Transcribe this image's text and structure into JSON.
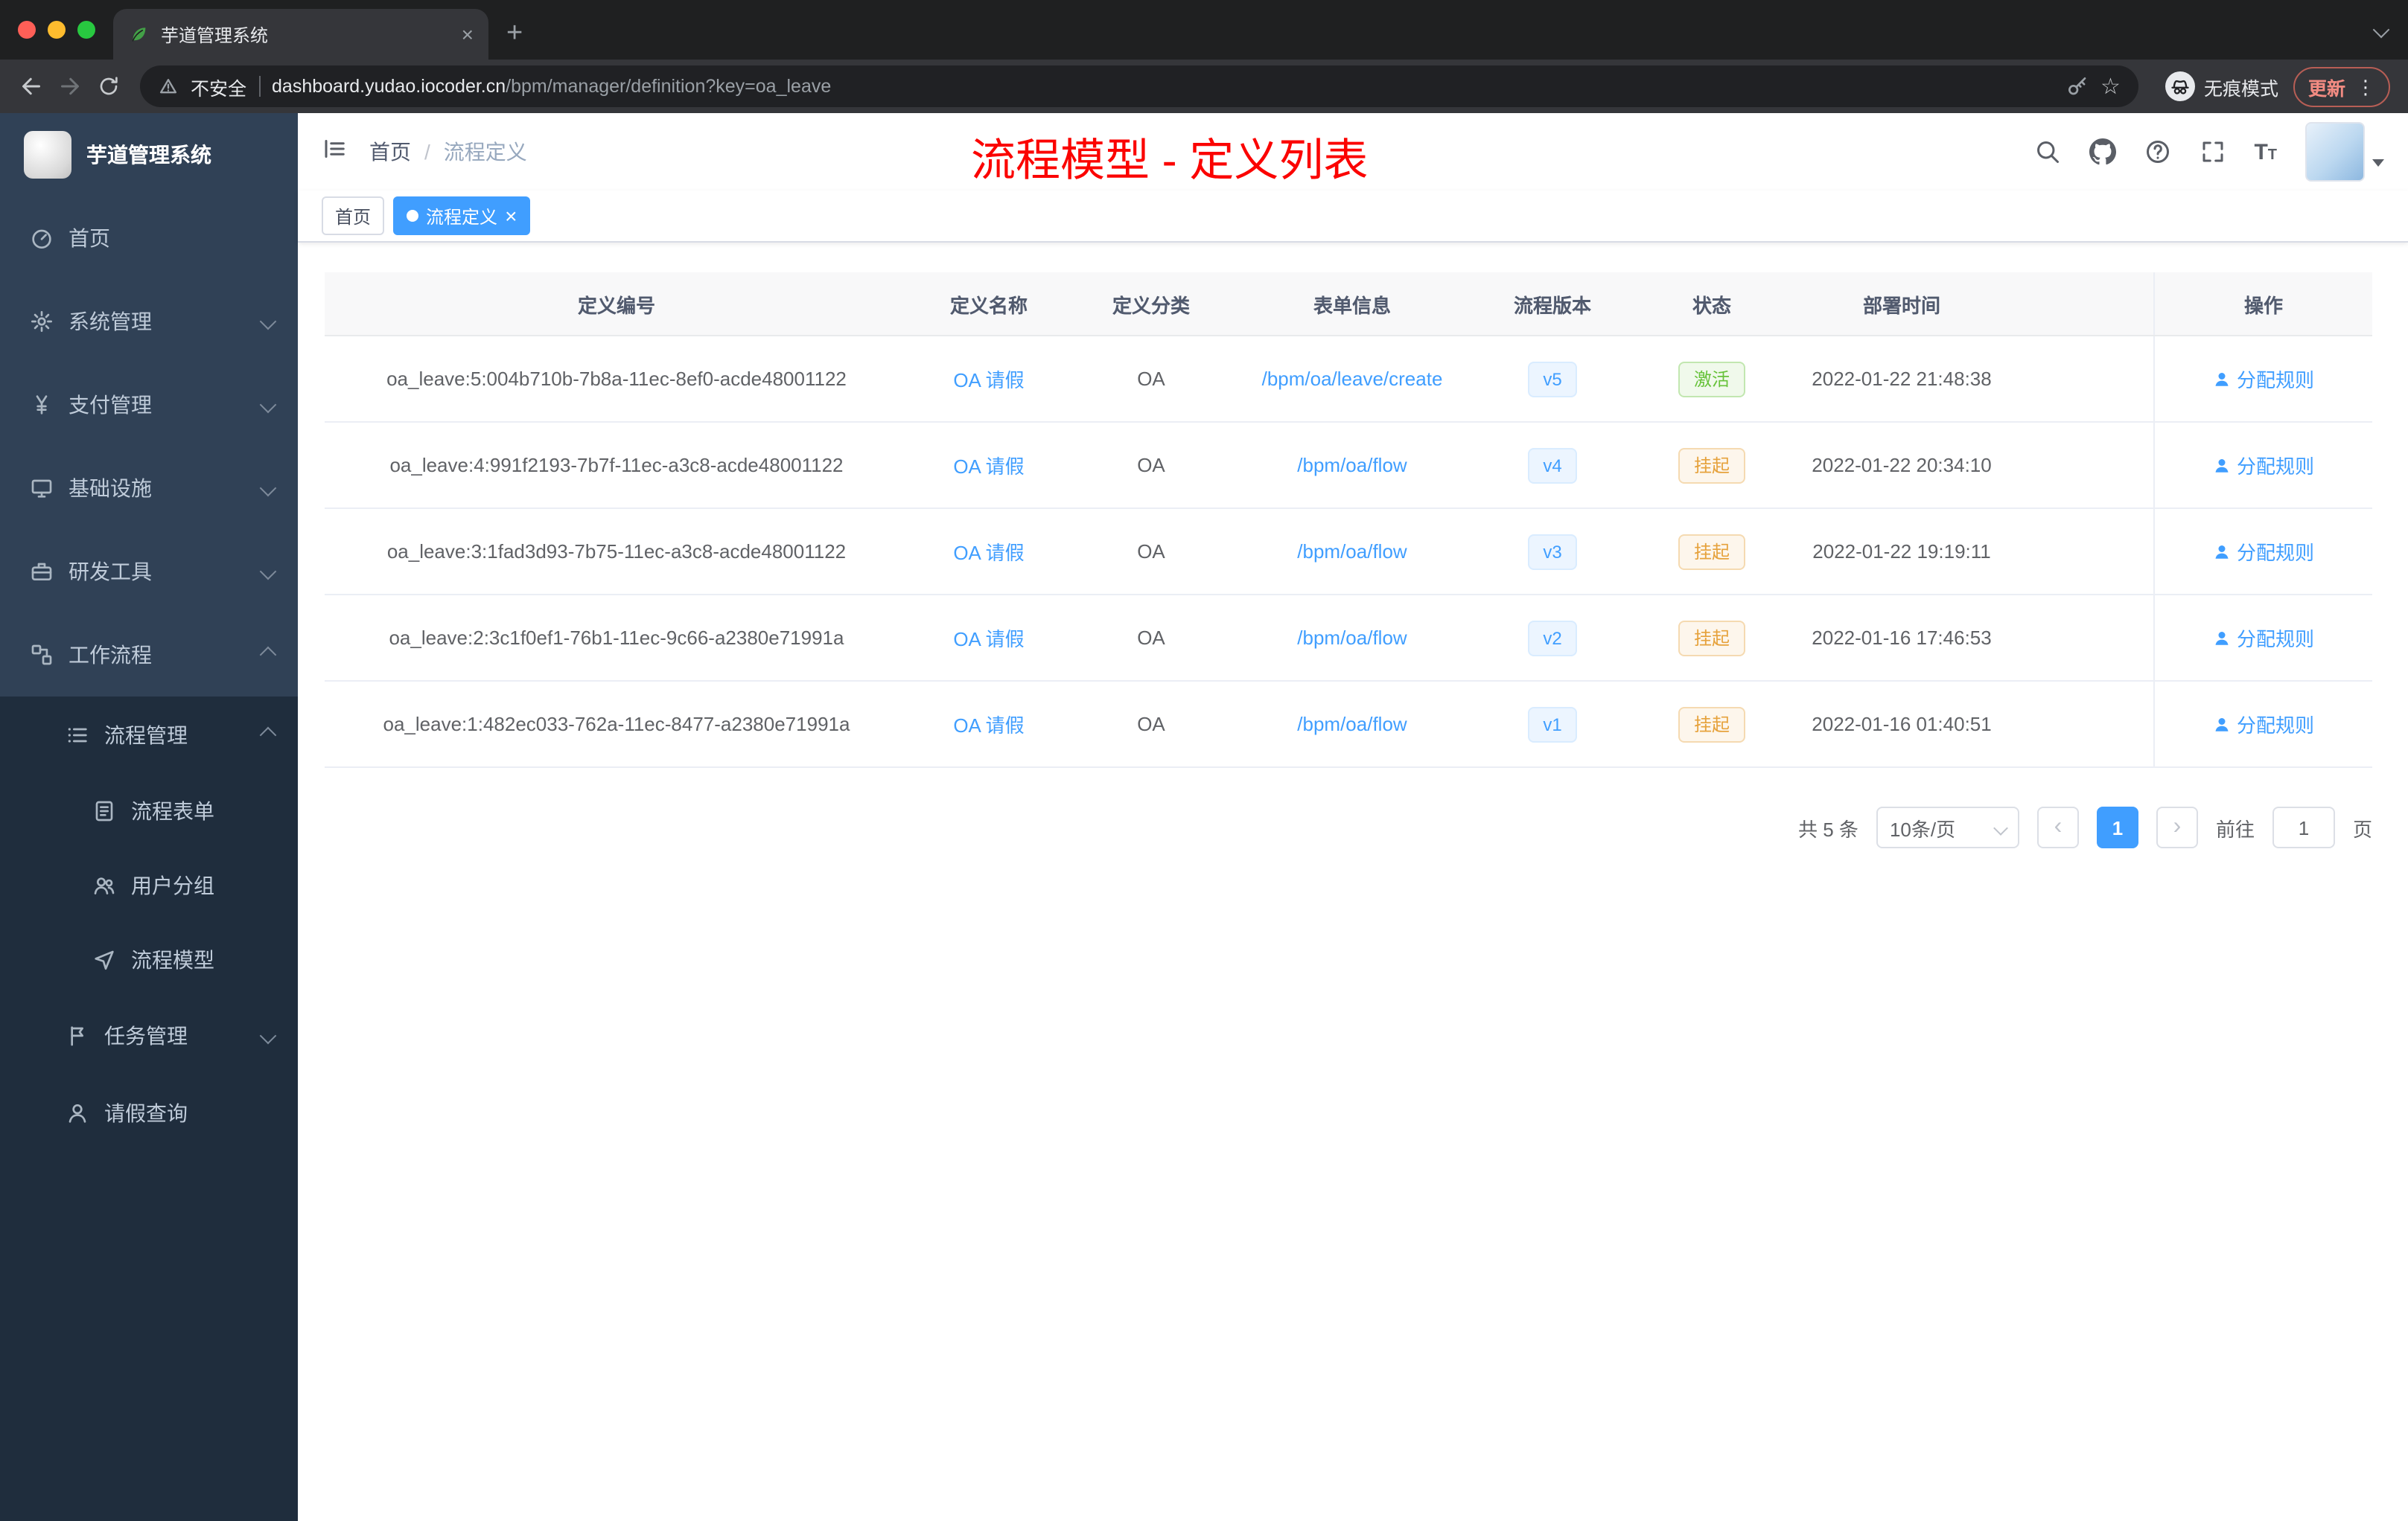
{
  "colors": {
    "accent": "#409eff",
    "success_text": "#67c23a",
    "warning_text": "#e6a23c",
    "annotation_red": "#fb0300",
    "sidebar_bg": "#304156",
    "submenu_bg": "#1f2d3d"
  },
  "browser": {
    "tab_title": "芋道管理系统",
    "security_label": "不安全",
    "url_host": "dashboard.yudao.iocoder.cn",
    "url_path": "/bpm/manager/definition?key=oa_leave",
    "incognito_label": "无痕模式",
    "update_label": "更新"
  },
  "sidebar": {
    "logo_title": "芋道管理系统",
    "main_items": [
      {
        "label": "首页",
        "icon": "dashboard-icon",
        "chevron": "none",
        "level": 0
      },
      {
        "label": "系统管理",
        "icon": "gear-icon",
        "chevron": "down",
        "level": 0
      },
      {
        "label": "支付管理",
        "icon": "yen-icon",
        "chevron": "down",
        "level": 0
      },
      {
        "label": "基础设施",
        "icon": "monitor-icon",
        "chevron": "down",
        "level": 0
      },
      {
        "label": "研发工具",
        "icon": "tools-icon",
        "chevron": "down",
        "level": 0
      },
      {
        "label": "工作流程",
        "icon": "workflow-icon",
        "chevron": "up",
        "level": 0
      }
    ],
    "sub_items": [
      {
        "label": "流程管理",
        "icon": "list-icon",
        "chevron": "up",
        "level": 1
      },
      {
        "label": "流程表单",
        "icon": "form-icon",
        "chevron": "none",
        "level": 2
      },
      {
        "label": "用户分组",
        "icon": "users-icon",
        "chevron": "none",
        "level": 2
      },
      {
        "label": "流程模型",
        "icon": "send-icon",
        "chevron": "none",
        "level": 2
      },
      {
        "label": "任务管理",
        "icon": "task-icon",
        "chevron": "down",
        "level": 1
      },
      {
        "label": "请假查询",
        "icon": "user-icon",
        "chevron": "none",
        "level": 1
      }
    ]
  },
  "header": {
    "breadcrumb_home": "首页",
    "breadcrumb_current": "流程定义",
    "annotation": "流程模型 - 定义列表"
  },
  "tags": [
    {
      "label": "首页",
      "state": "default"
    },
    {
      "label": "流程定义",
      "state": "active"
    }
  ],
  "table": {
    "columns": [
      "定义编号",
      "定义名称",
      "定义分类",
      "表单信息",
      "流程版本",
      "状态",
      "部署时间",
      "操作"
    ],
    "rows": [
      {
        "id": "oa_leave:5:004b710b-7b8a-11ec-8ef0-acde48001122",
        "name": "OA 请假",
        "category": "OA",
        "form": "/bpm/oa/leave/create",
        "version": "v5",
        "status": "激活",
        "status_type": "success",
        "deployed": "2022-01-22 21:48:38",
        "action": "分配规则"
      },
      {
        "id": "oa_leave:4:991f2193-7b7f-11ec-a3c8-acde48001122",
        "name": "OA 请假",
        "category": "OA",
        "form": "/bpm/oa/flow",
        "version": "v4",
        "status": "挂起",
        "status_type": "warning",
        "deployed": "2022-01-22 20:34:10",
        "action": "分配规则"
      },
      {
        "id": "oa_leave:3:1fad3d93-7b75-11ec-a3c8-acde48001122",
        "name": "OA 请假",
        "category": "OA",
        "form": "/bpm/oa/flow",
        "version": "v3",
        "status": "挂起",
        "status_type": "warning",
        "deployed": "2022-01-22 19:19:11",
        "action": "分配规则"
      },
      {
        "id": "oa_leave:2:3c1f0ef1-76b1-11ec-9c66-a2380e71991a",
        "name": "OA 请假",
        "category": "OA",
        "form": "/bpm/oa/flow",
        "version": "v2",
        "status": "挂起",
        "status_type": "warning",
        "deployed": "2022-01-16 17:46:53",
        "action": "分配规则"
      },
      {
        "id": "oa_leave:1:482ec033-762a-11ec-8477-a2380e71991a",
        "name": "OA 请假",
        "category": "OA",
        "form": "/bpm/oa/flow",
        "version": "v1",
        "status": "挂起",
        "status_type": "warning",
        "deployed": "2022-01-16 01:40:51",
        "action": "分配规则"
      }
    ]
  },
  "pagination": {
    "total": "共 5 条",
    "page_size": "10条/页",
    "current": "1",
    "goto_label": "前往",
    "page_unit": "页",
    "goto_value": "1"
  }
}
